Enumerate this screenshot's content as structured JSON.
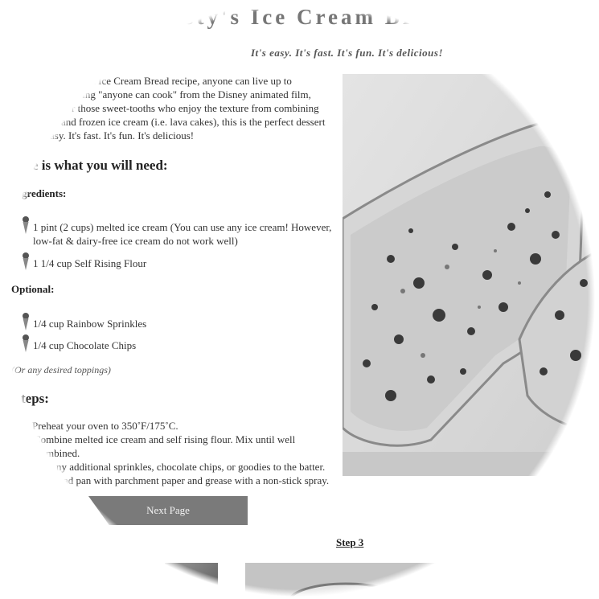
{
  "header": {
    "title": "sty's Ice Cream Br",
    "tagline": "It's easy. It's fast. It's fun. It's delicious!"
  },
  "intro": {
    "lines": [
      "ent Ice Cream Bread recipe, anyone can live up to",
      "aying \"anyone can cook\" from the Disney animated film,",
      "r those sweet-tooths who enjoy the texture from combining",
      "and frozen ice cream (i.e. lava cakes), this is the perfect dessert",
      "asy. It's fast. It's fun. It's delicious!"
    ]
  },
  "need_heading": "e is what you will need:",
  "ingredients": {
    "heading": "gredients:",
    "items": [
      {
        "line1": "1 pint (2 cups) melted ice cream (You can use any ice cream! However,",
        "line2": "low-fat & dairy-free ice cream do not work well)"
      },
      {
        "line1": "1 1/4 cup Self Rising Flour"
      }
    ]
  },
  "optional": {
    "heading": "Optional:",
    "items": [
      "1/4 cup Rainbow Sprinkles",
      "1/4 cup Chocolate Chips"
    ],
    "note": "(Or any desired toppings)"
  },
  "steps": {
    "heading": "teps:",
    "lines": [
      "Preheat your oven to 350˚F/175˚C.",
      "Combine melted ice cream and self rising flour. Mix until well",
      "mbined.",
      "ny additional sprinkles, chocolate chips, or goodies to the batter.",
      "ad pan with parchment paper and grease with a non-stick spray."
    ]
  },
  "next_button": "Next Page",
  "step3_link": "Step 3",
  "icons": {
    "list_bullet": "ice-cream-cone-icon"
  }
}
